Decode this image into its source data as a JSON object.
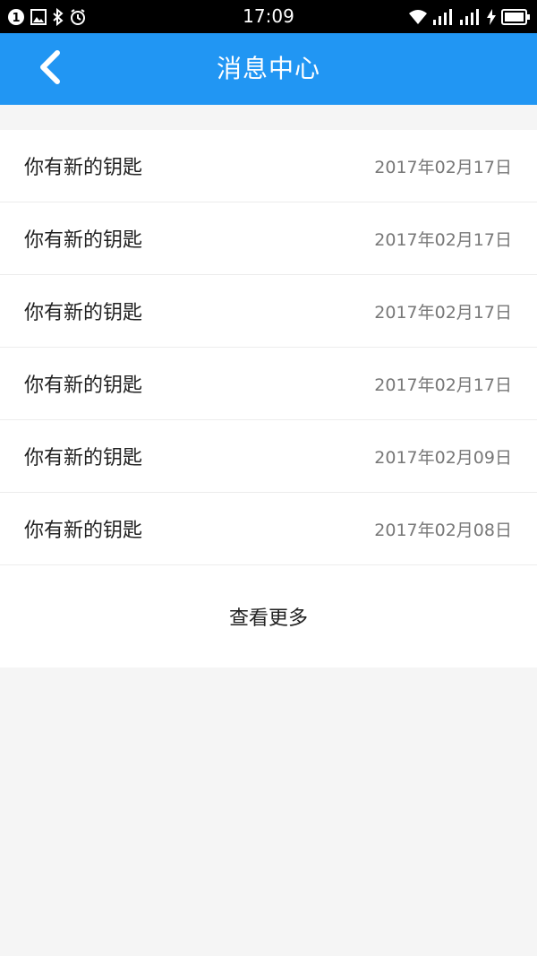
{
  "status_bar": {
    "time": "17:09",
    "left_icons": [
      "notification-count-icon",
      "image-icon",
      "bluetooth-icon",
      "alarm-icon"
    ],
    "right_icons": [
      "wifi-icon",
      "signal-icon",
      "signal-icon",
      "charging-icon",
      "battery-icon"
    ],
    "notification_count": "1"
  },
  "app_bar": {
    "title": "消息中心",
    "back_icon": "chevron-left-icon",
    "color": "#2196f3"
  },
  "messages": [
    {
      "title": "你有新的钥匙",
      "date": "2017年02月17日"
    },
    {
      "title": "你有新的钥匙",
      "date": "2017年02月17日"
    },
    {
      "title": "你有新的钥匙",
      "date": "2017年02月17日"
    },
    {
      "title": "你有新的钥匙",
      "date": "2017年02月17日"
    },
    {
      "title": "你有新的钥匙",
      "date": "2017年02月09日"
    },
    {
      "title": "你有新的钥匙",
      "date": "2017年02月08日"
    }
  ],
  "load_more_label": "查看更多"
}
